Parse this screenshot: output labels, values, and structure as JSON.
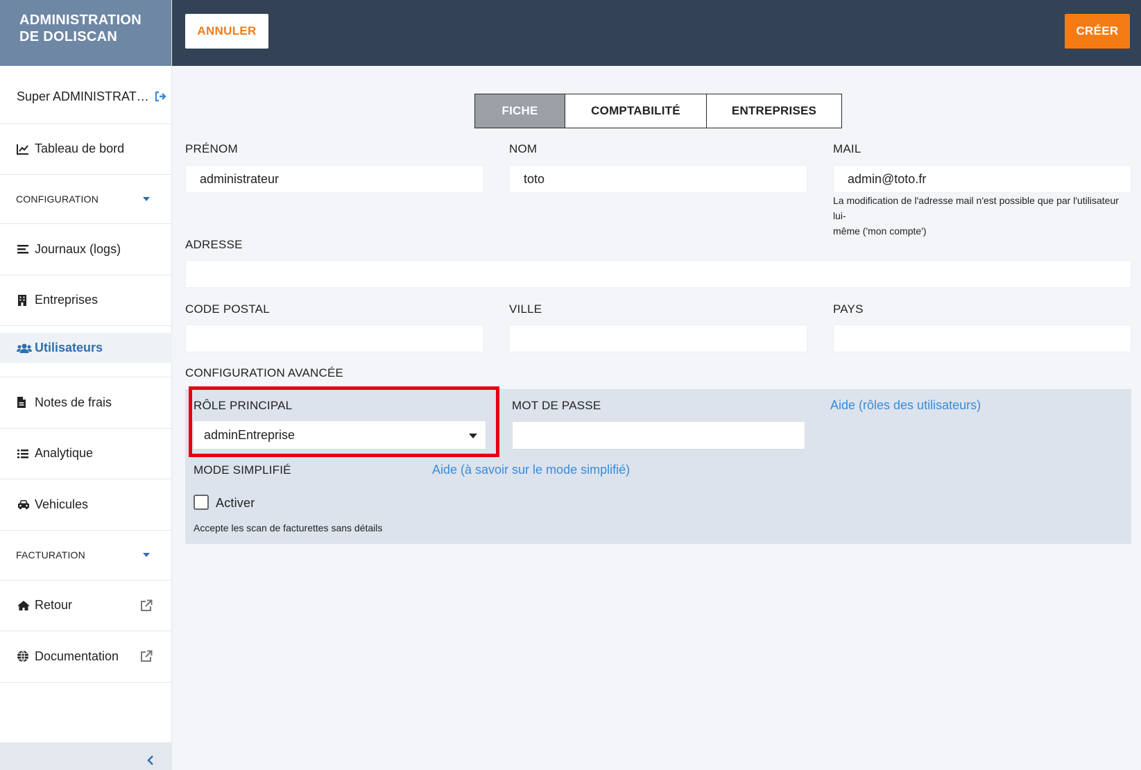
{
  "brand": {
    "line1": "ADMINISTRATION",
    "line2": "DE DOLISCAN"
  },
  "header": {
    "cancel_label": "ANNULER",
    "create_label": "CRÉER"
  },
  "sidebar": {
    "user": "Super ADMINISTRAT…",
    "items": [
      {
        "label": "Tableau de bord",
        "icon": "chart-line-icon"
      },
      {
        "label": "CONFIGURATION",
        "type": "section"
      },
      {
        "label": "Journaux (logs)",
        "icon": "list-lines-icon"
      },
      {
        "label": "Entreprises",
        "icon": "building-icon"
      },
      {
        "label": "Utilisateurs",
        "icon": "users-icon",
        "active": true
      },
      {
        "label": "Notes de frais",
        "icon": "file-icon"
      },
      {
        "label": "Analytique",
        "icon": "list-icon"
      },
      {
        "label": "Vehicules",
        "icon": "car-icon"
      },
      {
        "label": "FACTURATION",
        "type": "section"
      },
      {
        "label": "Retour",
        "icon": "home-icon"
      },
      {
        "label": "Documentation",
        "icon": "globe-icon"
      }
    ]
  },
  "tabs": [
    {
      "label": "FICHE",
      "active": true
    },
    {
      "label": "COMPTABILITÉ"
    },
    {
      "label": "ENTREPRISES"
    }
  ],
  "form": {
    "prenom": {
      "label": "PRÉNOM",
      "value": "administrateur"
    },
    "nom": {
      "label": "NOM",
      "value": "toto"
    },
    "mail": {
      "label": "MAIL",
      "value": "admin@toto.fr",
      "hint_line1": "La modification de l'adresse mail n'est possible que par l'utilisateur lui-",
      "hint_line2": "même ('mon compte')"
    },
    "adresse": {
      "label": "ADRESSE",
      "value": ""
    },
    "code_postal": {
      "label": "CODE POSTAL",
      "value": ""
    },
    "ville": {
      "label": "VILLE",
      "value": ""
    },
    "pays": {
      "label": "PAYS",
      "value": ""
    }
  },
  "advanced": {
    "title": "CONFIGURATION AVANCÉE",
    "role_label": "RÔLE PRINCIPAL",
    "role_value": "adminEntreprise",
    "password_label": "MOT DE PASSE",
    "password_value": "",
    "help_roles": "Aide (rôles des utilisateurs)",
    "simple_mode_label": "MODE SIMPLIFIÉ",
    "help_simple": "Aide (à savoir sur le mode simplifié)",
    "activate_label": "Activer",
    "activate_checked": false,
    "simple_hint": "Accepte les scan de facturettes sans détails"
  },
  "colors": {
    "accent": "#f57c14",
    "header_bg": "#344256",
    "brand_bg": "#6d87a5",
    "link": "#3b8bd6",
    "highlight": "#e60012"
  }
}
